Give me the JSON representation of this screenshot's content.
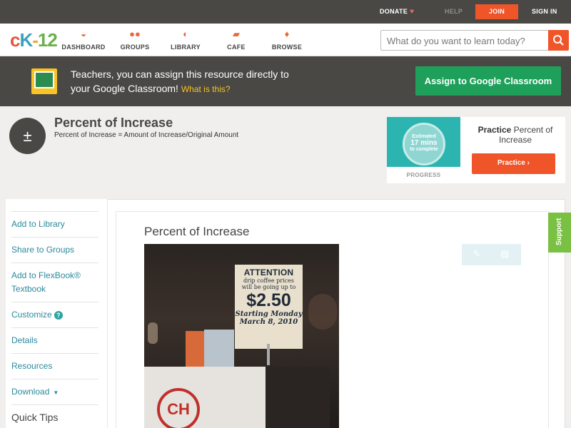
{
  "topbar": {
    "donate": "DONATE",
    "help": "HELP",
    "join": "JOIN",
    "signin": "SIGN IN"
  },
  "nav": {
    "logo": {
      "c": "c",
      "k": "K",
      "dash": "-",
      "num": "12"
    },
    "items": [
      {
        "label": "DASHBOARD",
        "icon": "dashboard-gauge-icon"
      },
      {
        "label": "GROUPS",
        "icon": "people-icon"
      },
      {
        "label": "LIBRARY",
        "icon": "bag-icon"
      },
      {
        "label": "CAFE",
        "icon": "chat-bubbles-icon"
      },
      {
        "label": "BROWSE",
        "icon": "lightbulb-icon"
      }
    ],
    "search_placeholder": "What do you want to learn today?"
  },
  "classroom": {
    "line1": "Teachers, you can assign this resource directly to",
    "line2": "your Google Classroom!",
    "what": "What is this?",
    "button": "Assign to Google Classroom"
  },
  "concept": {
    "title": "Percent of Increase",
    "subtitle": "Percent of Increase = Amount of Increase/Original Amount"
  },
  "practice": {
    "estimated": "Estimated",
    "mins": "17 mins",
    "to_complete": "to complete",
    "progress": "PROGRESS",
    "title_bold": "Practice",
    "title_rest": "Percent of Increase",
    "button": "Practice"
  },
  "sidebar": {
    "items": [
      {
        "label": "Add to Library"
      },
      {
        "label": "Share to Groups"
      },
      {
        "label": "Add to FlexBook® Textbook"
      },
      {
        "label": "Customize"
      },
      {
        "label": "Details"
      },
      {
        "label": "Resources"
      },
      {
        "label": "Download"
      },
      {
        "label": "Quick Tips"
      }
    ]
  },
  "article": {
    "title": "Percent of Increase"
  },
  "photo_sign": {
    "line1": "ATTENTION",
    "line2": "drip coffee prices",
    "line3": "will be going up to",
    "price": "$2.50",
    "line4": "Starting Monday",
    "line5": "March 8, 2010",
    "cup_text": "CH"
  },
  "support": "Support",
  "colors": {
    "accent": "#f0552a",
    "dark_bar": "#4a4845",
    "classroom_green": "#1fa05a",
    "link": "#2a8a9b",
    "support_green": "#7ac143"
  }
}
